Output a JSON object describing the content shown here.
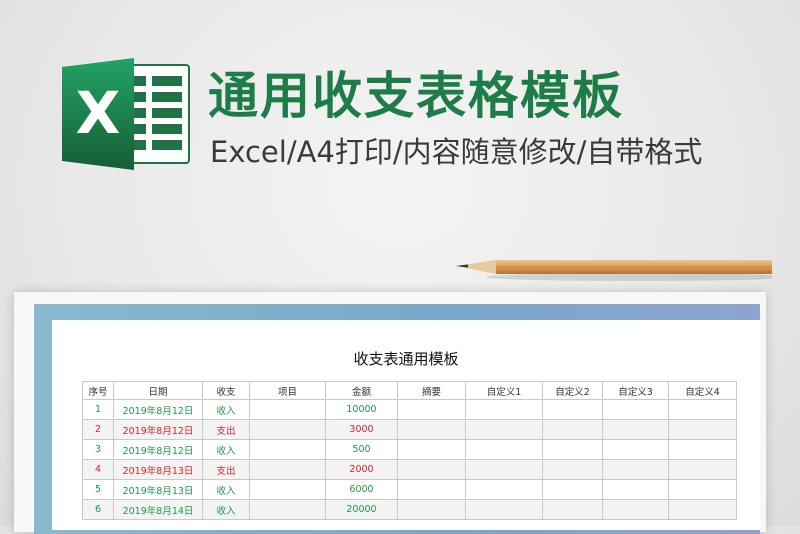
{
  "banner": {
    "title": "通用收支表格模板",
    "subtitle": "Excel/A4打印/内容随意修改/自带格式",
    "logo_letter": "X"
  },
  "colors": {
    "brand_green": "#1e7d47",
    "income": "#1f9a4a",
    "expense": "#e0212b"
  },
  "sheet": {
    "title": "收支表通用模板",
    "columns": [
      "序号",
      "日期",
      "收支",
      "项目",
      "金额",
      "摘要",
      "自定义1",
      "自定义2",
      "自定义3",
      "自定义4"
    ],
    "rows": [
      {
        "no": "1",
        "date": "2019年8月12日",
        "type": "收入",
        "item": "",
        "amount": "10000",
        "summary": "",
        "c1": "",
        "c2": "",
        "c3": "",
        "c4": ""
      },
      {
        "no": "2",
        "date": "2019年8月12日",
        "type": "支出",
        "item": "",
        "amount": "3000",
        "summary": "",
        "c1": "",
        "c2": "",
        "c3": "",
        "c4": ""
      },
      {
        "no": "3",
        "date": "2019年8月12日",
        "type": "收入",
        "item": "",
        "amount": "500",
        "summary": "",
        "c1": "",
        "c2": "",
        "c3": "",
        "c4": ""
      },
      {
        "no": "4",
        "date": "2019年8月13日",
        "type": "支出",
        "item": "",
        "amount": "2000",
        "summary": "",
        "c1": "",
        "c2": "",
        "c3": "",
        "c4": ""
      },
      {
        "no": "5",
        "date": "2019年8月13日",
        "type": "收入",
        "item": "",
        "amount": "6000",
        "summary": "",
        "c1": "",
        "c2": "",
        "c3": "",
        "c4": ""
      },
      {
        "no": "6",
        "date": "2019年8月14日",
        "type": "收入",
        "item": "",
        "amount": "20000",
        "summary": "",
        "c1": "",
        "c2": "",
        "c3": "",
        "c4": ""
      }
    ]
  }
}
